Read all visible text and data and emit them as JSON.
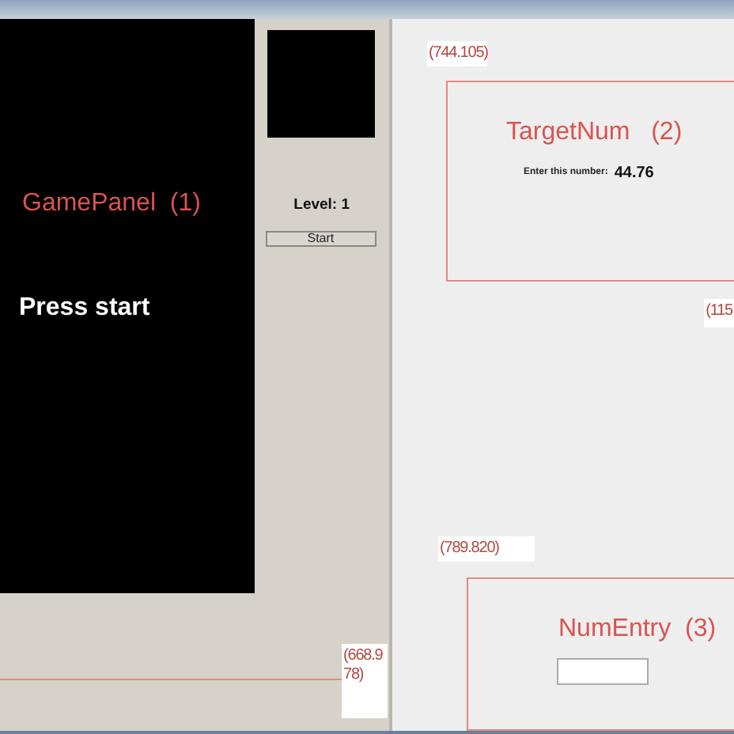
{
  "game_panel": {
    "annotation": "GamePanel  (1)",
    "message": "Press start",
    "coordinate": "(668.978)"
  },
  "side_panel": {
    "level_label": "Level: 1",
    "start_button": "Start"
  },
  "target_num": {
    "coordinate": "(744.105)",
    "annotation": "TargetNum   (2)",
    "prompt": "Enter this number:",
    "number": "44.76",
    "corner_coordinate": "(115"
  },
  "num_entry": {
    "coordinate": "(789.820)",
    "annotation": "NumEntry  (3)"
  }
}
